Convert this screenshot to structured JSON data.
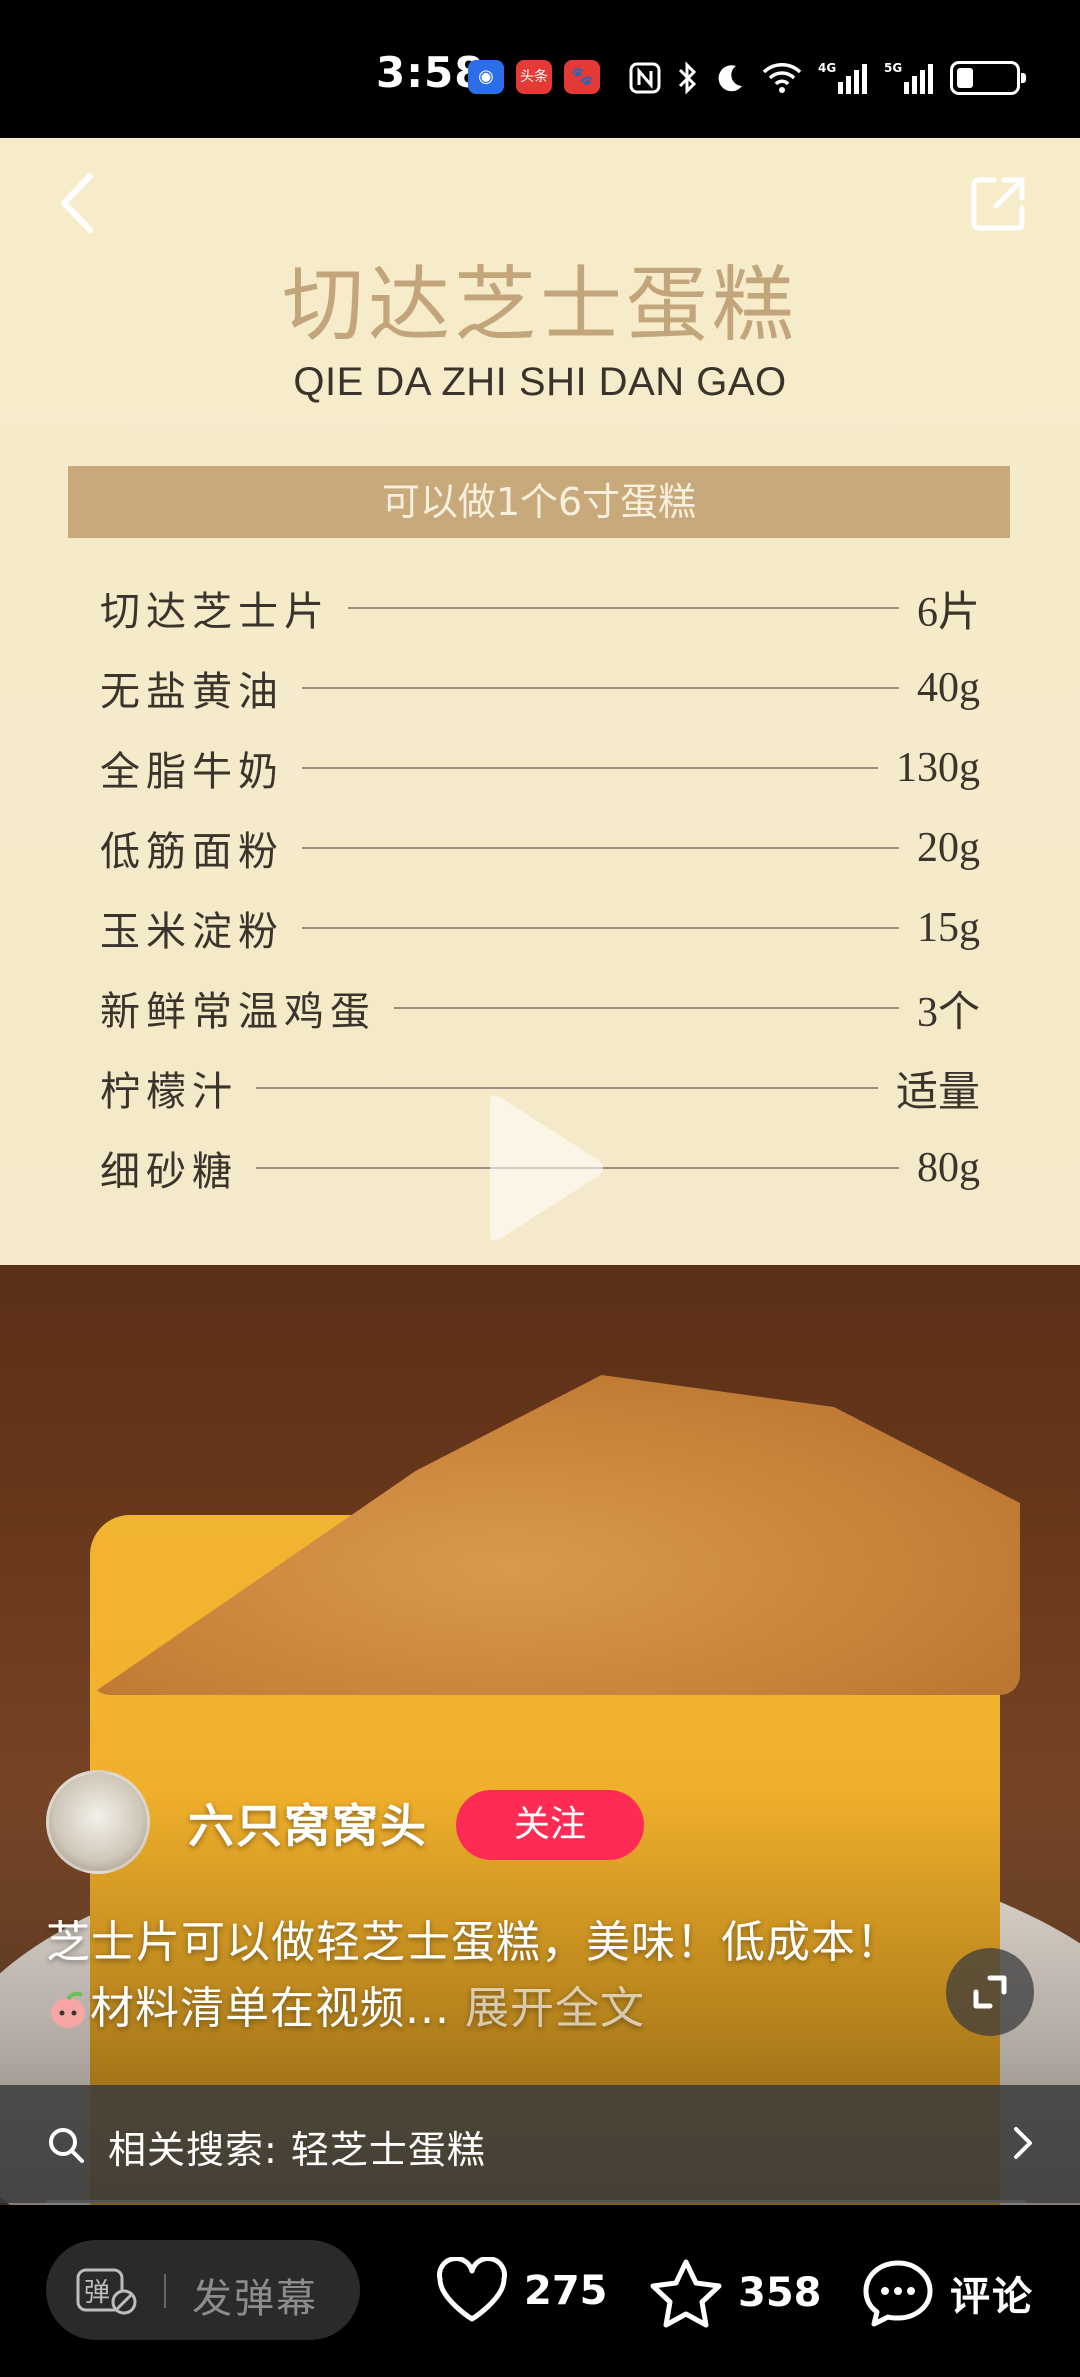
{
  "status_bar": {
    "time": "3:58",
    "app_badges": [
      "◉",
      "头条",
      "🐾"
    ],
    "network": "4G 5G"
  },
  "recipe": {
    "title": "切达芝士蛋糕",
    "pinyin": "QIE DA ZHI SHI DAN GAO",
    "serving": "可以做1个6寸蛋糕",
    "ingredients": [
      {
        "name": "切达芝士片",
        "qty": "6片"
      },
      {
        "name": "无盐黄油",
        "qty": "40g"
      },
      {
        "name": "全脂牛奶",
        "qty": "130g"
      },
      {
        "name": "低筋面粉",
        "qty": "20g"
      },
      {
        "name": "玉米淀粉",
        "qty": "15g"
      },
      {
        "name": "新鲜常温鸡蛋",
        "qty": "3个"
      },
      {
        "name": "柠檬汁",
        "qty": "适量"
      },
      {
        "name": "细砂糖",
        "qty": "80g"
      }
    ]
  },
  "author": {
    "name": "六只窝窝头",
    "follow_label": "关注"
  },
  "caption": {
    "text_part1": "芝士片可以做轻芝士蛋糕，美味！低成本！",
    "text_part2": "材料清单在视频...",
    "expand_label": "展开全文"
  },
  "related_search": {
    "label": "相关搜索: 轻芝士蛋糕"
  },
  "bottom_bar": {
    "danmu_icon_label": "弹",
    "danmu_placeholder": "发弹幕",
    "likes": "275",
    "favorites": "358",
    "comment_label": "评论"
  },
  "colors": {
    "follow": "#fe2c55",
    "recipe_bg": "#f6ecca",
    "serving_bar": "#c8a97c"
  }
}
